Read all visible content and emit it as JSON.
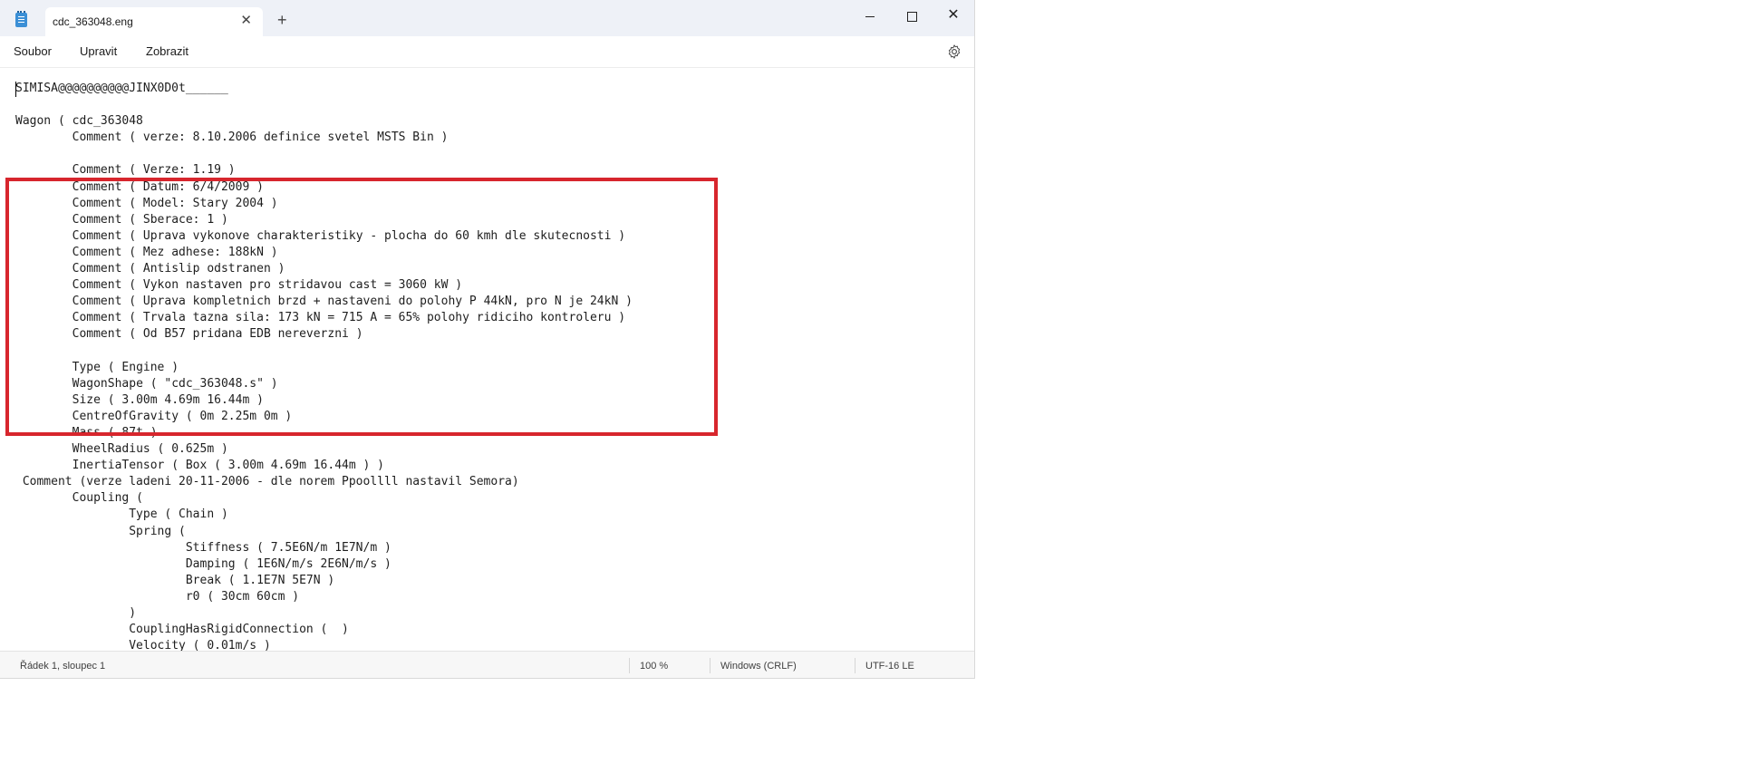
{
  "window": {
    "tab_title": "cdc_363048.eng",
    "close_tab_glyph": "✕",
    "new_tab_glyph": "+",
    "close_glyph": "✕"
  },
  "menu": {
    "file": "Soubor",
    "edit": "Upravit",
    "view": "Zobrazit"
  },
  "editor": {
    "lines": [
      "SIMISA@@@@@@@@@@JINX0D0t______",
      "",
      "Wagon ( cdc_363048",
      "\tComment ( verze: 8.10.2006 definice svetel MSTS Bin )",
      "",
      "\tComment ( Verze: 1.19 )",
      "\tComment ( Datum: 6/4/2009 )",
      "\tComment ( Model: Stary 2004 )",
      "\tComment ( Sberace: 1 )",
      "\tComment ( Uprava vykonove charakteristiky - plocha do 60 kmh dle skutecnosti )",
      "\tComment ( Mez adhese: 188kN )",
      "\tComment ( Antislip odstranen )",
      "\tComment ( Vykon nastaven pro stridavou cast = 3060 kW )",
      "\tComment ( Uprava kompletnich brzd + nastaveni do polohy P 44kN, pro N je 24kN )",
      "\tComment ( Trvala tazna sila: 173 kN = 715 A = 65% polohy ridiciho kontroleru )",
      "\tComment ( Od B57 pridana EDB nereverzni )",
      "",
      "\tType ( Engine )",
      "\tWagonShape ( \"cdc_363048.s\" )",
      "\tSize ( 3.00m 4.69m 16.44m )",
      "\tCentreOfGravity ( 0m 2.25m 0m )",
      "\tMass ( 87t )",
      "\tWheelRadius ( 0.625m )",
      "\tInertiaTensor ( Box ( 3.00m 4.69m 16.44m ) )",
      " Comment (verze ladeni 20-11-2006 - dle norem Ppoollll nastavil Semora)",
      "\tCoupling (",
      "\t\tType ( Chain )",
      "\t\tSpring (",
      "\t\t\tStiffness ( 7.5E6N/m 1E7N/m )",
      "\t\t\tDamping ( 1E6N/m/s 2E6N/m/s )",
      "\t\t\tBreak ( 1.1E7N 5E7N )",
      "\t\t\tr0 ( 30cm 60cm )",
      "\t\t)",
      "\t\tCouplingHasRigidConnection (  )",
      "\t\tVelocity ( 0.01m/s )"
    ]
  },
  "status": {
    "position": "Řádek 1, sloupec 1",
    "zoom": "100 %",
    "line_endings": "Windows (CRLF)",
    "encoding": "UTF-16 LE"
  },
  "colors": {
    "highlight": "#d7262d",
    "titlebar": "#eef1f7"
  }
}
